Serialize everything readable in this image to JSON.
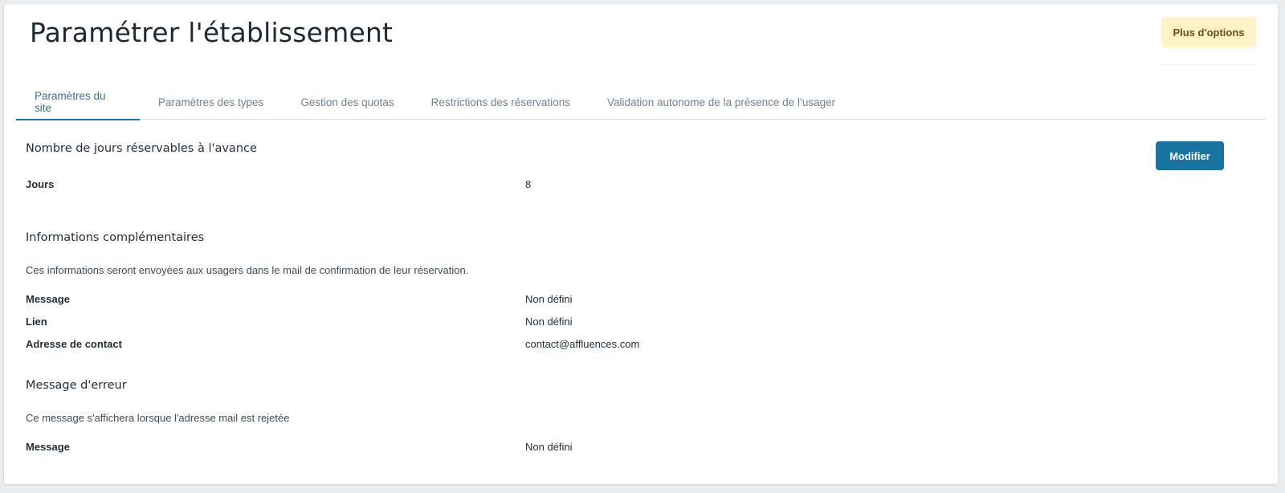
{
  "header": {
    "title": "Paramétrer l'établissement",
    "more_options_label": "Plus d'options"
  },
  "tabs": [
    {
      "label": "Paramètres du site",
      "active": true
    },
    {
      "label": "Paramètres des types",
      "active": false
    },
    {
      "label": "Gestion des quotas",
      "active": false
    },
    {
      "label": "Restrictions des réservations",
      "active": false
    },
    {
      "label": "Validation autonome de la présence de l’usager",
      "active": false
    }
  ],
  "advance_days": {
    "title": "Nombre de jours réservables à l'avance",
    "modify_label": "Modifier",
    "rows": [
      {
        "label": "Jours",
        "value": "8"
      }
    ]
  },
  "additional_info": {
    "title": "Informations complémentaires",
    "description": "Ces informations seront envoyées aux usagers dans le mail de confirmation de leur réservation.",
    "rows": [
      {
        "label": "Message",
        "value": "Non défini"
      },
      {
        "label": "Lien",
        "value": "Non défini"
      },
      {
        "label": "Adresse de contact",
        "value": "contact@affluences.com"
      }
    ]
  },
  "error_message": {
    "title": "Message d'erreur",
    "description": "Ce message s'affichera lorsque l'adresse mail est rejetée",
    "rows": [
      {
        "label": "Message",
        "value": "Non défini"
      }
    ]
  },
  "colors": {
    "primary": "#17739f",
    "warning_bg": "#fdf1c8",
    "warning_text": "#6b4f13",
    "tab_active": "#1a75a6"
  }
}
